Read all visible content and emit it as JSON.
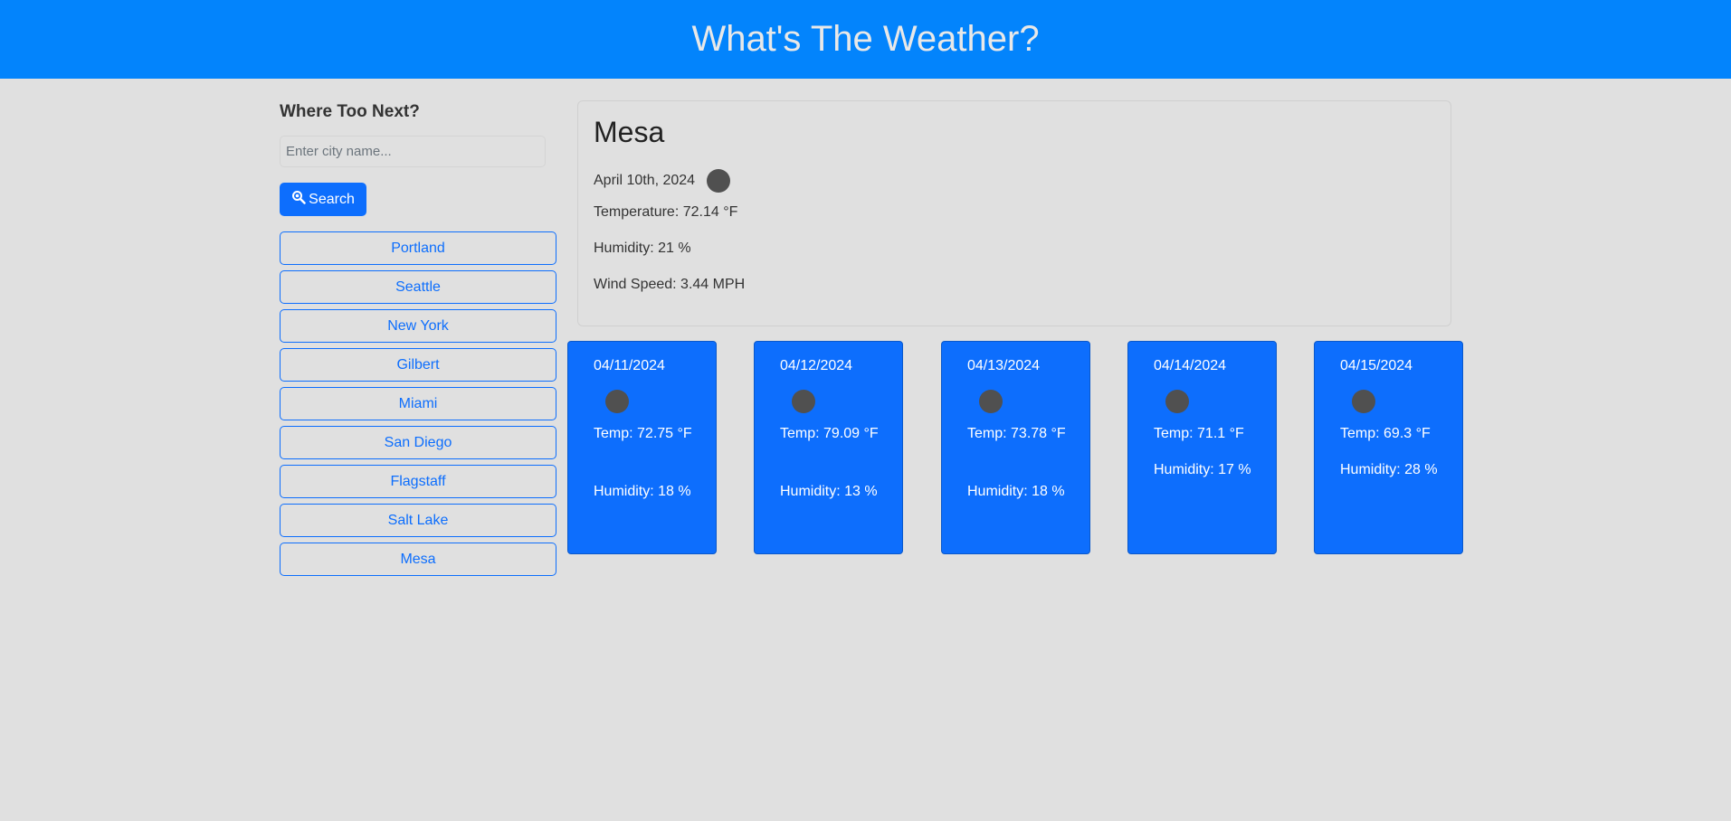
{
  "header": {
    "title": "What's The Weather?"
  },
  "sidebar": {
    "heading": "Where Too Next?",
    "search_placeholder": "Enter city name...",
    "search_value": "",
    "search_button_label": "Search",
    "history": [
      "Portland",
      "Seattle",
      "New York",
      "Gilbert",
      "Miami",
      "San Diego",
      "Flagstaff",
      "Salt Lake",
      "Mesa"
    ]
  },
  "current": {
    "city": "Mesa",
    "date": "April 10th, 2024",
    "temperature": "Temperature: 72.14 °F",
    "humidity": "Humidity: 21 %",
    "wind": "Wind Speed: 3.44 MPH"
  },
  "forecast": [
    {
      "date": "04/11/2024",
      "temp": "Temp: 72.75 °F",
      "humidity": "Humidity: 18 %"
    },
    {
      "date": "04/12/2024",
      "temp": "Temp: 79.09 °F",
      "humidity": "Humidity: 13 %"
    },
    {
      "date": "04/13/2024",
      "temp": "Temp: 73.78 °F",
      "humidity": "Humidity: 18 %"
    },
    {
      "date": "04/14/2024",
      "temp": "Temp: 71.1 °F",
      "humidity": "Humidity: 17 %"
    },
    {
      "date": "04/15/2024",
      "temp": "Temp: 69.3 °F",
      "humidity": "Humidity: 28 %"
    }
  ],
  "colors": {
    "header": "#0384fc",
    "accent": "#0d6efd",
    "background": "#e0e0e0",
    "icon": "#505050"
  },
  "icons": {
    "search_button": "magnifier-icon",
    "weather": "weather-icon"
  }
}
